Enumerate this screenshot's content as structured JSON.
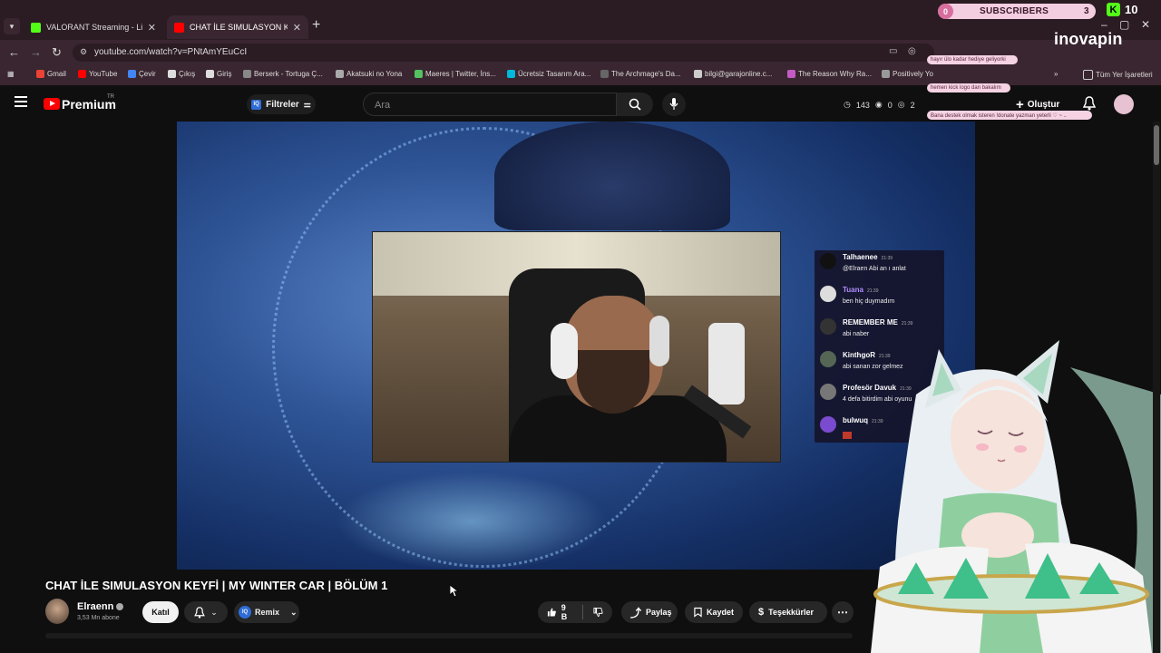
{
  "browser": {
    "tabs": [
      {
        "title": "VALORANT Streaming - Live Str",
        "favicon_color": "#53fc18",
        "active": false
      },
      {
        "title": "CHAT İLE SIMULASYON KEYFİ |",
        "favicon_color": "#ff0000",
        "active": true
      }
    ],
    "new_tab_symbol": "+",
    "url": "youtube.com/watch?v=PNtAmYEuCcI",
    "bookmarks": [
      "Gmail",
      "YouTube",
      "Çevir",
      "Çıkış",
      "Giriş",
      "Berserk - Tortuga Ç...",
      "Akatsuki no Yona",
      "Maeres | Twitter, İns...",
      "Ücretsiz Tasarım Ara...",
      "The Archmage's Da...",
      "bilgi@garajonline.c...",
      "The Reason Why Ra...",
      "Positively Yo"
    ],
    "all_bookmarks_label": "Tüm Yer İşaretleri",
    "overflow_symbol": "»"
  },
  "stream_overlay": {
    "subscribers_label": "SUBSCRIBERS",
    "subscribers_left": "0",
    "subscribers_count": "3",
    "kick_count": "10",
    "brand": "inovapin",
    "messages": [
      "hayır ülo kadar hediye geliyorki",
      "hemen kick logo dan bakalım",
      "Bana destek olmak isteren !donate yazman yeterli ♡ ~ .."
    ]
  },
  "youtube": {
    "logo_text": "Premium",
    "country": "TR",
    "filters_label": "Filtreler",
    "search_placeholder": "Ara",
    "stats": {
      "a": "143",
      "b": "0",
      "c": "2"
    },
    "create_label": "Oluştur"
  },
  "video_chat": [
    {
      "name": "Talhaenee",
      "time": "21:39",
      "text": "@Elraen Abi an ı anlat",
      "color": "#ffffff",
      "avatar": "#111111"
    },
    {
      "name": "Tuana",
      "time": "21:39",
      "text": "ben hiç duymadım",
      "color": "#b28cff",
      "avatar": "#dddddd"
    },
    {
      "name": "REMEMBER ME",
      "time": "21:39",
      "text": "abi naber",
      "color": "#ffffff",
      "avatar": "#333333"
    },
    {
      "name": "KinthgoR",
      "time": "21:39",
      "text": "abi sanan zor gelmez",
      "color": "#ffffff",
      "avatar": "#556655"
    },
    {
      "name": "Profesör Davuk",
      "time": "21:39",
      "text": "4 defa bitirdim abi oyunu",
      "color": "#ffffff",
      "avatar": "#777777"
    },
    {
      "name": "bulwuq",
      "time": "21:39",
      "text": "",
      "color": "#ffffff",
      "avatar": "#7b4bcf"
    }
  ],
  "video": {
    "title": "CHAT İLE SIMULASYON KEYFİ | MY WINTER CAR | BÖLÜM 1",
    "channel": "Elraenn",
    "subscribers": "3,53 Mn abone",
    "join_label": "Katıl",
    "remix_label": "Remix",
    "likes": "9 B",
    "share_label": "Paylaş",
    "save_label": "Kaydet",
    "thanks_label": "Teşekkürler"
  }
}
